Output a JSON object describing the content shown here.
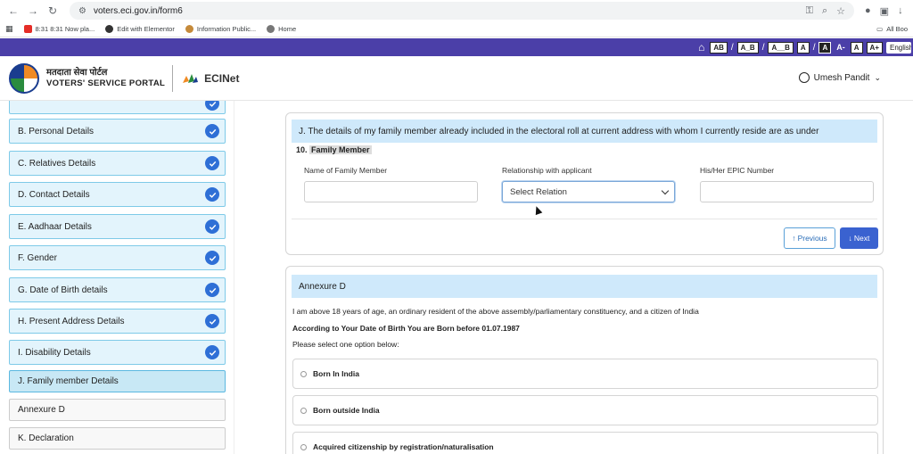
{
  "browser": {
    "url": "voters.eci.gov.in/form6",
    "bookmarks": [
      "8:31 8:31 Now pla...",
      "Edit with Elementor",
      "Information Public...",
      "Home"
    ],
    "all_bookmarks": "All Boo"
  },
  "accessibility": {
    "items": [
      "AB",
      "A_B",
      "A__B",
      "A",
      "A",
      "A-",
      "A",
      "A+"
    ],
    "language": "English"
  },
  "header": {
    "portal_hindi": "मतदाता सेवा पोर्टल",
    "portal_english": "VOTERS' SERVICE PORTAL",
    "eci_name": "ECINet",
    "user_name": "Umesh Pandit"
  },
  "sidebar": {
    "steps": [
      {
        "label": "",
        "state": "done"
      },
      {
        "label": "B. Personal Details",
        "state": "done"
      },
      {
        "label": "C. Relatives Details",
        "state": "done"
      },
      {
        "label": "D. Contact Details",
        "state": "done"
      },
      {
        "label": "E. Aadhaar Details",
        "state": "done"
      },
      {
        "label": "F. Gender",
        "state": "done"
      },
      {
        "label": "G. Date of Birth details",
        "state": "done"
      },
      {
        "label": "H. Present Address Details",
        "state": "done"
      },
      {
        "label": "I. Disability Details",
        "state": "done"
      },
      {
        "label": "J. Family member Details",
        "state": "current"
      },
      {
        "label": "Annexure D",
        "state": "pending"
      },
      {
        "label": "K. Declaration",
        "state": "pending"
      }
    ]
  },
  "section_j": {
    "heading": "J. The details of my family member already included in the electoral roll at current address with whom I currently reside are as under",
    "subtitle_number": "10.",
    "subtitle": "Family Member",
    "name_label": "Name of Family Member",
    "name_value": "",
    "relation_label": "Relationship with applicant",
    "relation_selected": "Select Relation",
    "epic_label": "His/Her EPIC Number",
    "epic_value": "",
    "previous_label": "Previous",
    "next_label": "Next"
  },
  "annexure": {
    "heading": "Annexure D",
    "statement": "I am above 18 years of age, an ordinary resident of the above assembly/parliamentary constituency, and a citizen of India",
    "dob_note": "According to Your Date of Birth You are Born before 01.07.1987",
    "instruction": "Please select one option below:",
    "options": [
      "Born In India",
      "Born outside India",
      "Acquired citizenship by registration/naturalisation"
    ]
  },
  "colors": {
    "accent": "#4b3fa8",
    "check": "#2e6fd6",
    "section_head": "#cfe9fb",
    "next_button": "#3a62d0"
  }
}
